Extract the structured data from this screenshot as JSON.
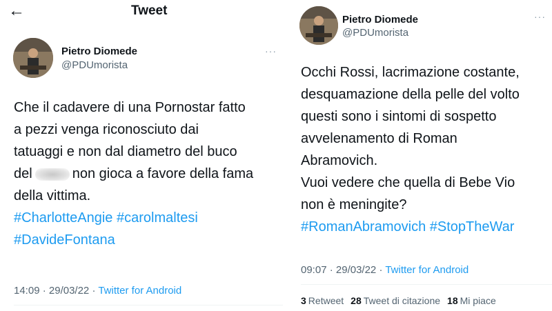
{
  "left": {
    "header_title": "Tweet",
    "author_name": "Pietro Diomede",
    "author_handle": "@PDUmorista",
    "more": "···",
    "text_lines": [
      "Che il cadavere di una Pornostar fatto",
      "a pezzi venga riconosciuto dai",
      "tatuaggi e non dal diametro del buco"
    ],
    "line4_before": "del",
    "line4_after": "non gioca a favore della fama",
    "line5": "della vittima.",
    "hashtags_line1": [
      "#CharlotteAngie",
      "#carolmaltesi"
    ],
    "hashtags_line2": [
      "#DavideFontana"
    ],
    "time": "14:09",
    "date": "29/03/22",
    "client": "Twitter for Android"
  },
  "right": {
    "author_name": "Pietro Diomede",
    "author_handle": "@PDUmorista",
    "more": "···",
    "text_lines": [
      "Occhi Rossi, lacrimazione costante,",
      "desquamazione della pelle del volto",
      "questi sono i sintomi di sospetto",
      "avvelenamento di Roman",
      "Abramovich.",
      "Vuoi vedere che quella di Bebe Vio",
      "non è meningite?"
    ],
    "hashtags": [
      "#RomanAbramovich",
      "#StopTheWar"
    ],
    "time": "09:07",
    "date": "29/03/22",
    "client": "Twitter for Android",
    "stats": [
      {
        "count": "3",
        "label": "Retweet"
      },
      {
        "count": "28",
        "label": "Tweet di citazione"
      },
      {
        "count": "18",
        "label": "Mi piace"
      }
    ]
  }
}
